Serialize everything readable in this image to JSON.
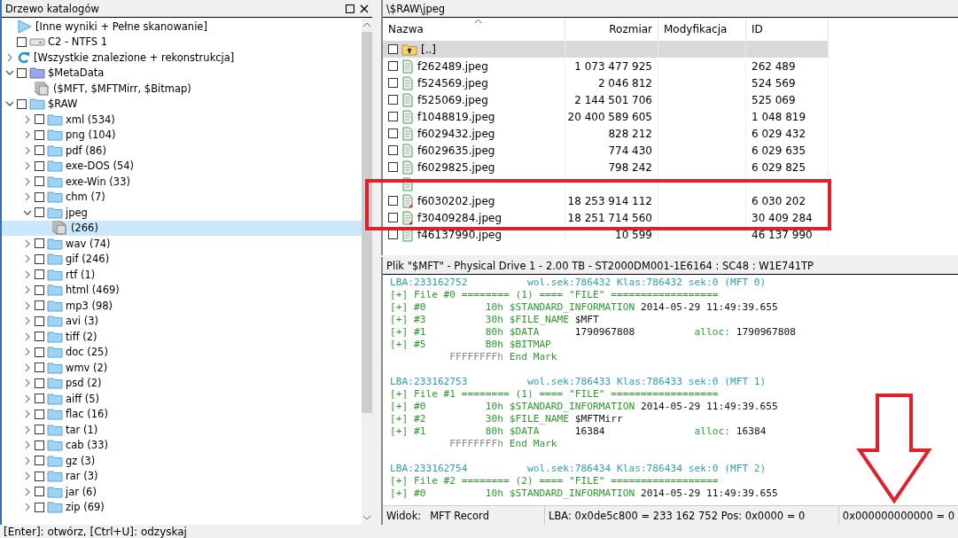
{
  "tree_panel": {
    "title": "Drzewo katalogów",
    "items": [
      {
        "label": "[Inne wyniki + Pełne skanowanie]",
        "kind": "scan",
        "selected": false
      },
      {
        "label": "C2 - NTFS 1",
        "kind": "drive",
        "checked": false,
        "selected": false
      },
      {
        "label": "[Wszystkie znalezione + rekonstrukcja]",
        "kind": "refresh",
        "expanded": false,
        "selected": false
      },
      {
        "label": "$MetaData",
        "kind": "system-folder",
        "checked": false,
        "expanded": true,
        "selected": false,
        "children": [
          {
            "label": "($MFT, $MFTMirr, $Bitmap)",
            "kind": "files",
            "selected": false
          }
        ]
      },
      {
        "label": "$RAW",
        "kind": "folder",
        "checked": false,
        "expanded": true,
        "selected": false,
        "children": [
          {
            "label": "xml (534)",
            "kind": "folder",
            "checked": false,
            "expanded": false,
            "selected": false
          },
          {
            "label": "png (104)",
            "kind": "folder",
            "checked": false,
            "expanded": false,
            "selected": false
          },
          {
            "label": "pdf (86)",
            "kind": "folder",
            "checked": false,
            "expanded": false,
            "selected": false
          },
          {
            "label": "exe-DOS (54)",
            "kind": "folder",
            "checked": false,
            "expanded": false,
            "selected": false
          },
          {
            "label": "exe-Win (33)",
            "kind": "folder",
            "checked": false,
            "expanded": false,
            "selected": false
          },
          {
            "label": "chm (7)",
            "kind": "folder",
            "checked": false,
            "expanded": false,
            "selected": false
          },
          {
            "label": "jpeg",
            "kind": "folder",
            "checked": false,
            "expanded": true,
            "selected": false,
            "children": [
              {
                "label": "(266)",
                "kind": "files",
                "selected": true
              }
            ]
          },
          {
            "label": "wav (74)",
            "kind": "folder",
            "checked": false,
            "expanded": false,
            "selected": false
          },
          {
            "label": "gif (246)",
            "kind": "folder",
            "checked": false,
            "expanded": false,
            "selected": false
          },
          {
            "label": "rtf (1)",
            "kind": "folder",
            "checked": false,
            "expanded": false,
            "selected": false
          },
          {
            "label": "html (469)",
            "kind": "folder",
            "checked": false,
            "expanded": false,
            "selected": false
          },
          {
            "label": "mp3 (98)",
            "kind": "folder",
            "checked": false,
            "expanded": false,
            "selected": false
          },
          {
            "label": "avi (3)",
            "kind": "folder",
            "checked": false,
            "expanded": false,
            "selected": false
          },
          {
            "label": "tiff (2)",
            "kind": "folder",
            "checked": false,
            "expanded": false,
            "selected": false
          },
          {
            "label": "doc (25)",
            "kind": "folder",
            "checked": false,
            "expanded": false,
            "selected": false
          },
          {
            "label": "wmv (2)",
            "kind": "folder",
            "checked": false,
            "expanded": false,
            "selected": false
          },
          {
            "label": "psd (2)",
            "kind": "folder",
            "checked": false,
            "expanded": false,
            "selected": false
          },
          {
            "label": "aiff (5)",
            "kind": "folder",
            "checked": false,
            "expanded": false,
            "selected": false
          },
          {
            "label": "flac (16)",
            "kind": "folder",
            "checked": false,
            "expanded": false,
            "selected": false
          },
          {
            "label": "tar (1)",
            "kind": "folder",
            "checked": false,
            "expanded": false,
            "selected": false
          },
          {
            "label": "cab (33)",
            "kind": "folder",
            "checked": false,
            "expanded": false,
            "selected": false
          },
          {
            "label": "gz (3)",
            "kind": "folder",
            "checked": false,
            "expanded": false,
            "selected": false
          },
          {
            "label": "rar (3)",
            "kind": "folder",
            "checked": false,
            "expanded": false,
            "selected": false
          },
          {
            "label": "jar (6)",
            "kind": "folder",
            "checked": false,
            "expanded": false,
            "selected": false
          },
          {
            "label": "zip (69)",
            "kind": "folder",
            "checked": false,
            "expanded": false,
            "selected": false
          }
        ]
      }
    ]
  },
  "file_list": {
    "path": "\\$RAW\\jpeg",
    "columns": [
      "Nazwa",
      "Rozmiar",
      "Modyfikacja",
      "ID"
    ],
    "rows": [
      {
        "name": "[..]",
        "kind": "parent",
        "size": "",
        "id": "",
        "checked": false,
        "selected": true
      },
      {
        "name": "f262489.jpeg",
        "kind": "file",
        "size": "1 073 477 925",
        "id": "262 489",
        "checked": false,
        "selected": false
      },
      {
        "name": "f524569.jpeg",
        "kind": "file",
        "size": "2 046 812",
        "id": "524 569",
        "checked": false,
        "selected": false
      },
      {
        "name": "f525069.jpeg",
        "kind": "file",
        "size": "2 144 501 706",
        "id": "525 069",
        "checked": false,
        "selected": false
      },
      {
        "name": "f1048819.jpeg",
        "kind": "file",
        "size": "20 400 589 605",
        "id": "1 048 819",
        "checked": false,
        "selected": false
      },
      {
        "name": "f6029432.jpeg",
        "kind": "file",
        "size": "828 212",
        "id": "6 029 432",
        "checked": false,
        "selected": false
      },
      {
        "name": "f6029635.jpeg",
        "kind": "file",
        "size": "774 430",
        "id": "6 029 635",
        "checked": false,
        "selected": false
      },
      {
        "name": "f6029825.jpeg",
        "kind": "file",
        "size": "798 242",
        "id": "6 029 825",
        "checked": false,
        "selected": false
      },
      {
        "kind": "file",
        "selected": false
      },
      {
        "name": "f6030202.jpeg",
        "kind": "damaged-file",
        "size": "18 253 914 112",
        "id": "6 030 202",
        "checked": false,
        "selected": false
      },
      {
        "name": "f30409284.jpeg",
        "kind": "damaged-file",
        "size": "18 251 714 560",
        "id": "30 409 284",
        "checked": false,
        "selected": false
      },
      {
        "name": "f46137990.jpeg",
        "kind": "file",
        "size": "10 599",
        "id": "46 137 990",
        "checked": false,
        "selected": false
      }
    ]
  },
  "record_view": {
    "title": "Plik \"$MFT\" - Physical Drive 1 - 2.00 TB - ST2000DM001-1E6164 : SC48 : W1E741TP",
    "records": [
      {
        "lines": [
          [
            {
              "text": "LBA:233162752          wol.sek:786432 Klas:786432 sek:0 (MFT 0)",
              "kind": "address"
            }
          ],
          [
            {
              "text": "[+] File #0 ======== (1) ==== \"FILE\" ==================",
              "kind": "key"
            }
          ],
          [
            {
              "text": "[+] #0          10h $STANDARD_INFORMATION ",
              "kind": "key"
            },
            {
              "text": "2014-05-29 11:49:39.655",
              "kind": "value"
            }
          ],
          [
            {
              "text": "[+] #3          30h $FILE_NAME ",
              "kind": "key"
            },
            {
              "text": "$MFT",
              "kind": "value"
            }
          ],
          [
            {
              "text": "[+] #1          80h $DATA      ",
              "kind": "key"
            },
            {
              "text": "1790967808",
              "kind": "value"
            },
            {
              "text": "          alloc: ",
              "kind": "key"
            },
            {
              "text": "1790967808",
              "kind": "value"
            }
          ],
          [
            {
              "text": "[+] #5          B0h $BITMAP",
              "kind": "key"
            }
          ],
          [
            {
              "text": "          FFFFFFFFh",
              "kind": "dim"
            },
            {
              "text": " End Mark",
              "kind": "key"
            }
          ]
        ]
      },
      {
        "lines": [
          [
            {
              "text": "LBA:233162753          wol.sek:786433 Klas:786433 sek:0 (MFT 1)",
              "kind": "address"
            }
          ],
          [
            {
              "text": "[+] File #1 ======== (1) ==== \"FILE\" ==================",
              "kind": "key"
            }
          ],
          [
            {
              "text": "[+] #0          10h $STANDARD_INFORMATION ",
              "kind": "key"
            },
            {
              "text": "2014-05-29 11:49:39.655",
              "kind": "value"
            }
          ],
          [
            {
              "text": "[+] #2          30h $FILE_NAME ",
              "kind": "key"
            },
            {
              "text": "$MFTMirr",
              "kind": "value"
            }
          ],
          [
            {
              "text": "[+] #1          80h $DATA      ",
              "kind": "key"
            },
            {
              "text": "16384",
              "kind": "value"
            },
            {
              "text": "               alloc: ",
              "kind": "key"
            },
            {
              "text": "16384",
              "kind": "value"
            }
          ],
          [
            {
              "text": "          FFFFFFFFh",
              "kind": "dim"
            },
            {
              "text": " End Mark",
              "kind": "key"
            }
          ]
        ]
      },
      {
        "lines": [
          [
            {
              "text": "LBA:233162754          wol.sek:786434 Klas:786434 sek:0 (MFT 2)",
              "kind": "address"
            }
          ],
          [
            {
              "text": "[+] File #2 ======== (2) ==== \"FILE\" ==================",
              "kind": "key"
            }
          ],
          [
            {
              "text": "[+] #0          10h $STANDARD_INFORMATION ",
              "kind": "key"
            },
            {
              "text": "2014-05-29 11:49:39.655",
              "kind": "value"
            }
          ]
        ]
      }
    ],
    "status": {
      "view_label": "Widok:",
      "view_value": "MFT Record",
      "position": "LBA: 0x0de5c800 = 233 162 752  Pos: 0x0000 = 0",
      "offset": "0x000000000000 = 0"
    }
  },
  "hint_bar": "[Enter]: otwórz, [Ctrl+U]: odzyskaj"
}
